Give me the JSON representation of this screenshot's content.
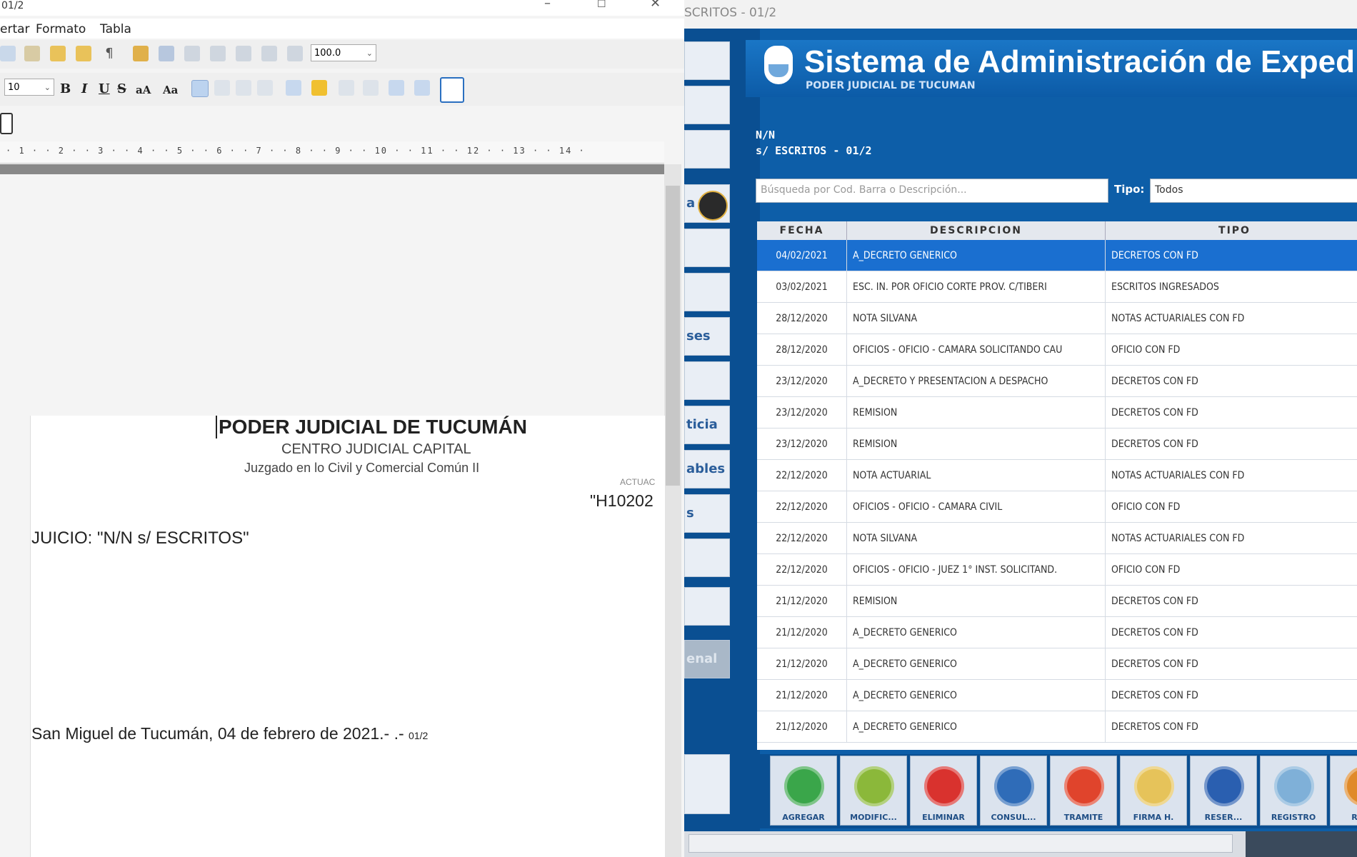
{
  "editor": {
    "title": "01/2",
    "menu": [
      "ertar",
      "Formato",
      "Tabla"
    ],
    "zoom": "100.0",
    "font_size": "10",
    "format_buttons": [
      "B",
      "I",
      "U",
      "S",
      "aA",
      "Aa"
    ],
    "ruler": "· 1 · · 2 · · 3 · · 4 · · 5 · · 6 · · 7 · · 8 · · 9 · · 10 · · 11 · · 12 · · 13 · · 14 ·",
    "document": {
      "heading": "PODER JUDICIAL DE TUCUMÁN",
      "center": "CENTRO JUDICIAL CAPITAL",
      "court": "Juzgado en lo Civil y Comercial Común II",
      "actuac_label": "ACTUAC",
      "actuac_code": "\"H10202",
      "juicio": "JUICIO: \"N/N s/ ESCRITOS\"",
      "date_line": "San Miguel de Tucumán, 04 de febrero de 2021.- .-",
      "date_suffix": "01/2"
    }
  },
  "app": {
    "window_title": "SCRITOS - 01/2",
    "header_title": "Sistema de Administración de Expedient",
    "header_subtitle": "PODER JUDICIAL DE TUCUMAN",
    "case_line1": "N/N",
    "case_line2": "s/ ESCRITOS - 01/2",
    "search_placeholder": "Búsqueda por Cod. Barra o Descripción...",
    "tipo_label": "Tipo:",
    "tipo_value": "Todos",
    "sidebar_items": [
      "",
      "",
      "",
      "a",
      "",
      "",
      "ses",
      "",
      "ticia",
      "ables",
      "s",
      "",
      "",
      "enal"
    ],
    "columns": [
      "FECHA",
      "DESCRIPCION",
      "TIPO"
    ],
    "rows": [
      {
        "fecha": "04/02/2021",
        "desc": "A_DECRETO GENERICO",
        "tipo": "DECRETOS CON FD"
      },
      {
        "fecha": "03/02/2021",
        "desc": "ESC. IN. POR OFICIO CORTE PROV. C/TIBERI",
        "tipo": "ESCRITOS INGRESADOS"
      },
      {
        "fecha": "28/12/2020",
        "desc": "NOTA SILVANA",
        "tipo": "NOTAS ACTUARIALES CON FD"
      },
      {
        "fecha": "28/12/2020",
        "desc": "OFICIOS - OFICIO - CAMARA SOLICITANDO CAU",
        "tipo": "OFICIO CON FD"
      },
      {
        "fecha": "23/12/2020",
        "desc": "A_DECRETO Y PRESENTACION A DESPACHO",
        "tipo": "DECRETOS CON FD"
      },
      {
        "fecha": "23/12/2020",
        "desc": "REMISION",
        "tipo": "DECRETOS CON FD"
      },
      {
        "fecha": "23/12/2020",
        "desc": "REMISION",
        "tipo": "DECRETOS CON FD"
      },
      {
        "fecha": "22/12/2020",
        "desc": "NOTA ACTUARIAL",
        "tipo": "NOTAS ACTUARIALES CON FD"
      },
      {
        "fecha": "22/12/2020",
        "desc": "OFICIOS - OFICIO - CAMARA CIVIL",
        "tipo": "OFICIO CON FD"
      },
      {
        "fecha": "22/12/2020",
        "desc": "NOTA SILVANA",
        "tipo": "NOTAS ACTUARIALES CON FD"
      },
      {
        "fecha": "22/12/2020",
        "desc": "OFICIOS - OFICIO - JUEZ 1° INST. SOLICITAND.",
        "tipo": "OFICIO CON FD"
      },
      {
        "fecha": "21/12/2020",
        "desc": "REMISION",
        "tipo": "DECRETOS CON FD"
      },
      {
        "fecha": "21/12/2020",
        "desc": "A_DECRETO GENERICO",
        "tipo": "DECRETOS CON FD"
      },
      {
        "fecha": "21/12/2020",
        "desc": "A_DECRETO GENERICO",
        "tipo": "DECRETOS CON FD"
      },
      {
        "fecha": "21/12/2020",
        "desc": "A_DECRETO GENERICO",
        "tipo": "DECRETOS CON FD"
      },
      {
        "fecha": "21/12/2020",
        "desc": "A_DECRETO GENERICO",
        "tipo": "DECRETOS CON FD"
      }
    ],
    "buttons": [
      {
        "label": "AGREGAR",
        "icon": "plus-icon",
        "color": "#3aa64a"
      },
      {
        "label": "MODIFIC...",
        "icon": "pencil-icon",
        "color": "#8bb83a"
      },
      {
        "label": "ELIMINAR",
        "icon": "minus-icon",
        "color": "#d9322e"
      },
      {
        "label": "CONSUL...",
        "icon": "magnifier-icon",
        "color": "#2f6cb8"
      },
      {
        "label": "TRAMITE",
        "icon": "export-icon",
        "color": "#e0442c"
      },
      {
        "label": "FIRMA H.",
        "icon": "signature-icon",
        "color": "#e6c35a"
      },
      {
        "label": "RESER...",
        "icon": "lock-icon",
        "color": "#2a5fb0"
      },
      {
        "label": "REGISTRO",
        "icon": "register-icon",
        "color": "#7fb0d8"
      },
      {
        "label": "REPO",
        "icon": "report-icon",
        "color": "#e08a2a"
      }
    ],
    "colors": {
      "app_blue": "#0d5ea8",
      "selected_row": "#1a6fd0"
    }
  }
}
